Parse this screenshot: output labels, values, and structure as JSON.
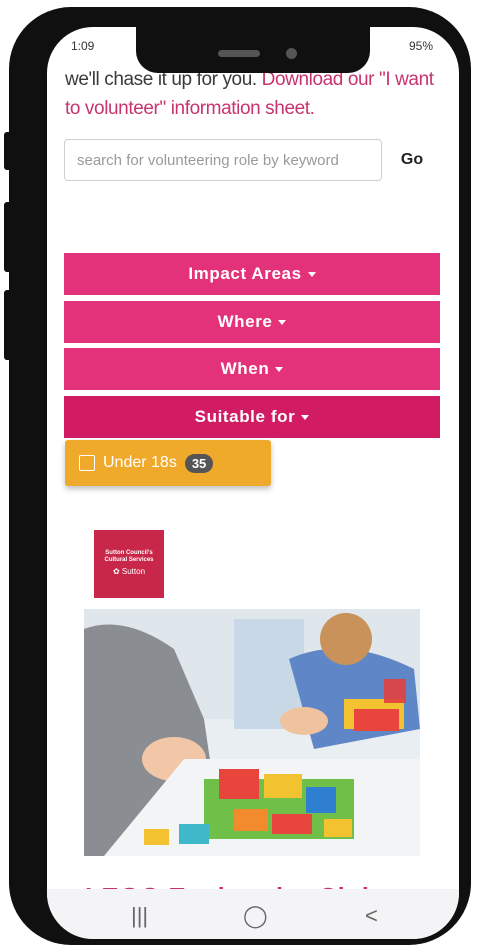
{
  "status": {
    "time": "1:09",
    "battery": "95%"
  },
  "intro": {
    "prefix": "we'll chase it up for you. ",
    "link": "Download our \"I want to volunteer\" information sheet."
  },
  "search": {
    "placeholder": "search for volunteering role by keyword",
    "go_label": "Go"
  },
  "filters": {
    "impact": "Impact Areas",
    "where": "Where",
    "when": "When",
    "suitable": "Suitable for"
  },
  "under18": {
    "label": "Under 18s",
    "count": "35"
  },
  "logo": {
    "line1": "Sutton Council's",
    "line2": "Cultural Services",
    "name": "Sutton"
  },
  "listing": {
    "title_peek": "LEGO Explorador Club"
  },
  "navbar": {
    "recents": "|||",
    "home": "◯",
    "back": "<"
  },
  "colors": {
    "accent": "#e3317a",
    "accent_dark": "#d11b63",
    "badge_orange": "#f0aa2b",
    "link": "#c8346e"
  }
}
